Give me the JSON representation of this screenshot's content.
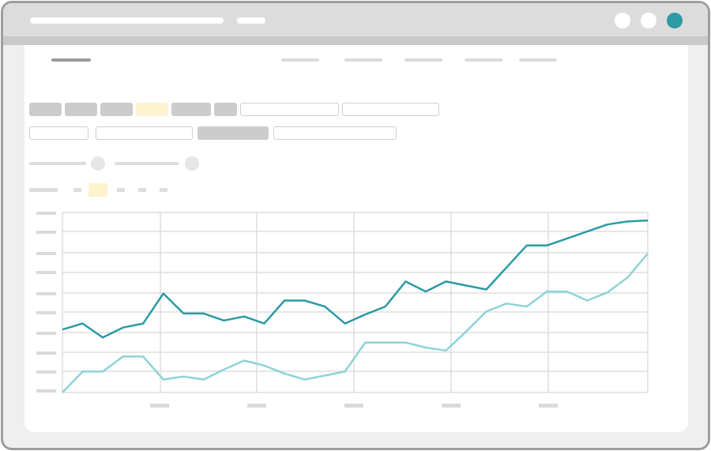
{
  "colors": {
    "accent": "#2b9aa4",
    "accent_light": "#8ed3d6",
    "highlight": "#fdf3cf",
    "grid": "#dddddd",
    "placeholder": "#cccccc"
  },
  "icons": {
    "minimize": "circle-button-icon",
    "maximize": "circle-button-icon",
    "close": "circle-button-icon"
  },
  "chart_data": {
    "type": "line",
    "x": [
      0,
      1,
      2,
      3,
      4,
      5,
      6,
      7,
      8,
      9,
      10,
      11,
      12,
      13,
      14,
      15,
      16,
      17,
      18,
      19,
      20,
      21,
      22,
      23,
      24,
      25,
      26,
      27,
      28,
      29
    ],
    "series": [
      {
        "color": "#2b9aa4",
        "values": [
          3.15,
          3.45,
          2.75,
          3.25,
          3.45,
          4.95,
          3.95,
          3.95,
          3.6,
          3.8,
          3.45,
          4.6,
          4.6,
          4.3,
          3.45,
          3.9,
          4.3,
          5.55,
          5.05,
          5.55,
          5.35,
          5.15,
          6.25,
          7.35,
          7.35,
          7.7,
          8.05,
          8.4,
          8.55,
          8.6
        ]
      },
      {
        "color": "#8ed3d6",
        "values": [
          0.0,
          1.05,
          1.05,
          1.8,
          1.8,
          0.65,
          0.8,
          0.65,
          1.15,
          1.6,
          1.35,
          0.95,
          0.65,
          0.85,
          1.05,
          2.5,
          2.5,
          2.5,
          2.25,
          2.1,
          3.05,
          4.05,
          4.45,
          4.3,
          5.05,
          5.05,
          4.6,
          5.0,
          5.75,
          6.95
        ]
      }
    ],
    "ylim": [
      0,
      9
    ],
    "grid": true
  }
}
